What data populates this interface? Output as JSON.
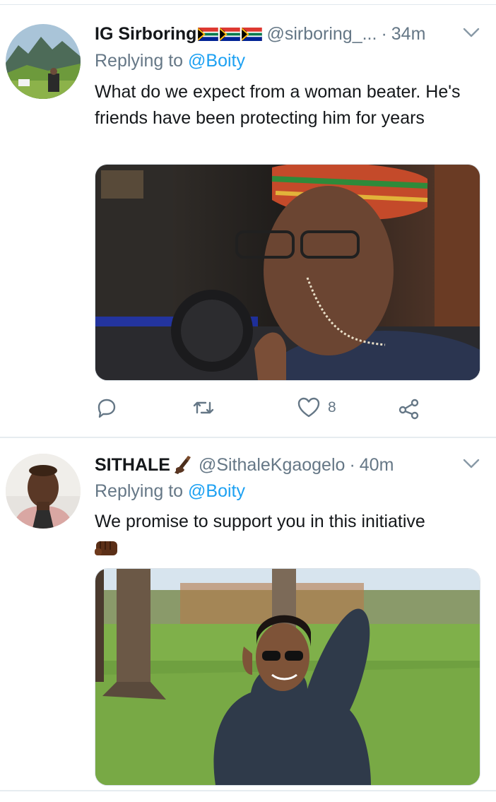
{
  "tweets": [
    {
      "name": "IG Sirboring",
      "handle": "@sirboring_...",
      "time": "34m",
      "replying_prefix": "Replying to",
      "replying_to": "@Boity",
      "text": "What do we expect from a woman beater. He's friends have been protecting him for years",
      "flag_icons": [
        "south-africa-flag-icon",
        "south-africa-flag-icon",
        "south-africa-flag-icon"
      ],
      "like_count": "8"
    },
    {
      "name": "SITHALE",
      "handle": "@SithaleKgaogelo",
      "time": "40m",
      "replying_prefix": "Replying to",
      "replying_to": "@Boity",
      "text": "We promise to support you in this initiative",
      "emoji_icon": "raised-fist-emoji-icon"
    }
  ],
  "colors": {
    "accent": "#1da1f2",
    "secondary_text": "#657786",
    "divider": "#e6ecf0"
  }
}
